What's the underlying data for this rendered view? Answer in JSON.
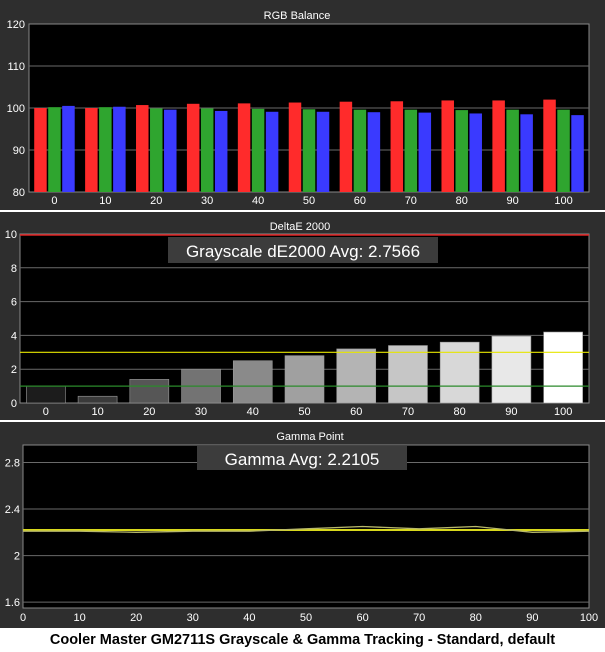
{
  "caption": "Cooler Master GM2711S Grayscale & Gamma Tracking - Standard, default",
  "colors": {
    "background": "#2e2e2e",
    "plot_background": "#000000",
    "grid": "#6a6a6a",
    "text": "#ffffff",
    "red_series": "#ff2b2b",
    "green_series": "#2fa52f",
    "blue_series": "#3a3aff",
    "threshold_upper": "#e6e600",
    "threshold_lower": "#2b8a2b",
    "gamma_line": "#d8d81c",
    "reference_line": "#e02020"
  },
  "chart_data": [
    {
      "type": "bar",
      "title": "RGB Balance",
      "categories": [
        "0",
        "10",
        "20",
        "30",
        "40",
        "50",
        "60",
        "70",
        "80",
        "90",
        "100"
      ],
      "series": [
        {
          "name": "Red",
          "color": "#ff2b2b",
          "values": [
            100.0,
            100.0,
            100.7,
            101.0,
            101.1,
            101.3,
            101.5,
            101.6,
            101.8,
            101.8,
            102.0
          ]
        },
        {
          "name": "Green",
          "color": "#2fa52f",
          "values": [
            100.2,
            100.2,
            99.9,
            99.9,
            99.8,
            99.7,
            99.6,
            99.6,
            99.5,
            99.6,
            99.6
          ]
        },
        {
          "name": "Blue",
          "color": "#3a3aff",
          "values": [
            100.5,
            100.3,
            99.6,
            99.3,
            99.1,
            99.1,
            99.0,
            98.9,
            98.7,
            98.5,
            98.3
          ]
        }
      ],
      "yticks": [
        80,
        90,
        100,
        110,
        120
      ],
      "ylim": [
        80,
        120
      ]
    },
    {
      "type": "bar",
      "title": "DeltaE 2000",
      "categories": [
        "0",
        "10",
        "20",
        "30",
        "40",
        "50",
        "60",
        "70",
        "80",
        "90",
        "100"
      ],
      "values": [
        1.0,
        0.4,
        1.4,
        2.0,
        2.5,
        2.8,
        3.2,
        3.4,
        3.6,
        3.95,
        4.2
      ],
      "bar_grays": [
        "#1c1c1c",
        "#3a3a3a",
        "#565656",
        "#737373",
        "#8a8a8a",
        "#a0a0a0",
        "#b4b4b4",
        "#c6c6c6",
        "#d8d8d8",
        "#e8e8e8",
        "#ffffff"
      ],
      "annotation": "Grayscale dE2000 Avg: 2.7566",
      "thresholds": [
        3,
        1
      ],
      "reference": 10,
      "yticks": [
        0,
        2,
        4,
        6,
        8,
        10
      ],
      "ylim": [
        0,
        10
      ]
    },
    {
      "type": "line",
      "title": "Gamma Point",
      "x": [
        0,
        10,
        20,
        30,
        40,
        50,
        60,
        70,
        80,
        90,
        100
      ],
      "series": [
        {
          "name": "Measured",
          "values": [
            2.21,
            2.21,
            2.2,
            2.21,
            2.21,
            2.23,
            2.25,
            2.23,
            2.25,
            2.2,
            2.21
          ]
        }
      ],
      "target": 2.22,
      "annotation": "Gamma Avg: 2.2105",
      "xticks": [
        0,
        10,
        20,
        30,
        40,
        50,
        60,
        70,
        80,
        90,
        100
      ],
      "yticks": [
        1.6,
        2.0,
        2.4,
        2.8
      ],
      "ytick_labels": [
        "1.6",
        "2",
        "2.4",
        "2.8"
      ],
      "xlim": [
        0,
        100
      ],
      "ylim": [
        1.55,
        2.95
      ]
    }
  ]
}
